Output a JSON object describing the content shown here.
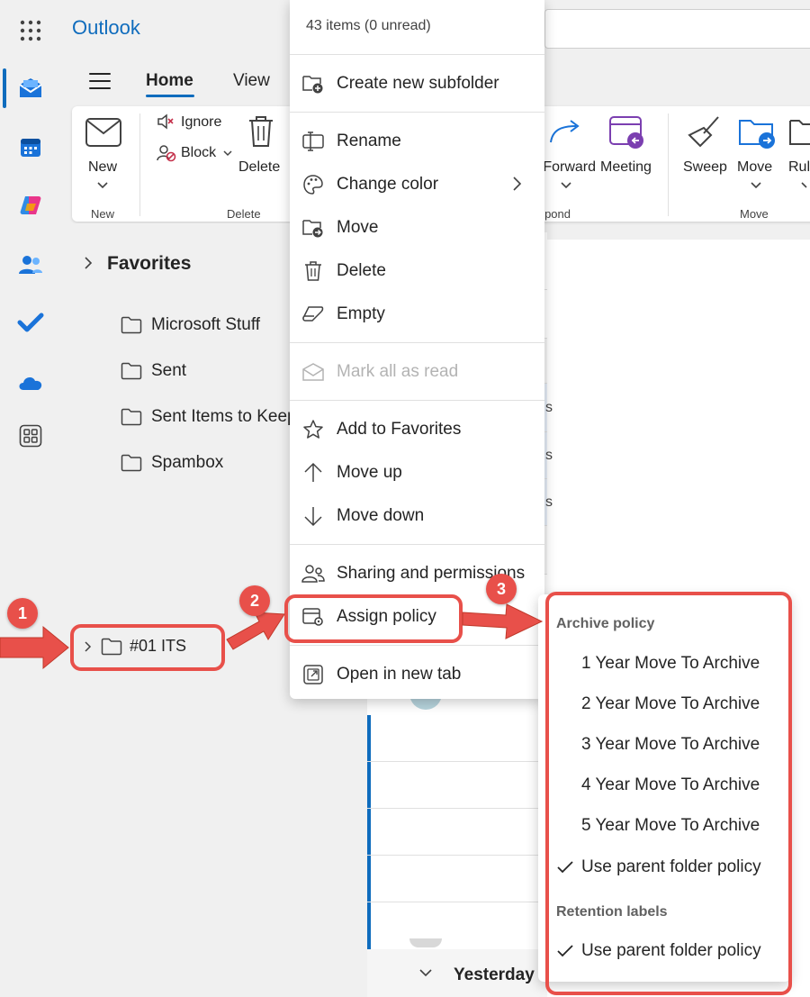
{
  "app": {
    "title": "Outlook"
  },
  "header": {
    "search_placeholder": ""
  },
  "tabs": [
    {
      "label": "Home"
    },
    {
      "label": "View"
    }
  ],
  "ribbon": {
    "new_label": "New",
    "new_group": "New",
    "ignore_label": "Ignore",
    "block_label": "Block",
    "delete_label": "Delete",
    "delete_group": "Delete",
    "forward_label": "Forward",
    "meeting_label": "Meeting",
    "respond_group": "Respond",
    "sweep_label": "Sweep",
    "move_label": "Move",
    "rules_label": "Rules",
    "move_group": "Move"
  },
  "nav": {
    "favorites_label": "Favorites",
    "folders": [
      "Microsoft Stuff",
      "Sent",
      "Sent Items to Keep",
      "Spambox"
    ],
    "selected_folder": "#01 ITS"
  },
  "message_list": {
    "snippets": [
      "s",
      "s",
      "s"
    ],
    "group_label": "Yesterday"
  },
  "context_menu": {
    "header": "43 items (0 unread)",
    "items": [
      {
        "label": "Create new subfolder",
        "icon": "folder-add-icon"
      },
      {
        "label": "Rename",
        "icon": "rename-icon"
      },
      {
        "label": "Change color",
        "icon": "palette-icon"
      },
      {
        "label": "Move",
        "icon": "folder-move-icon"
      },
      {
        "label": "Delete",
        "icon": "trash-icon"
      },
      {
        "label": "Empty",
        "icon": "eraser-icon"
      },
      {
        "label": "Mark all as read",
        "icon": "mail-read-icon",
        "disabled": true
      },
      {
        "label": "Add to Favorites",
        "icon": "star-icon"
      },
      {
        "label": "Move up",
        "icon": "arrow-up-icon"
      },
      {
        "label": "Move down",
        "icon": "arrow-down-icon"
      },
      {
        "label": "Sharing and permissions",
        "icon": "people-icon"
      },
      {
        "label": "Assign policy",
        "icon": "policy-icon"
      },
      {
        "label": "Open in new tab",
        "icon": "open-new-icon"
      }
    ]
  },
  "submenu": {
    "archive_heading": "Archive policy",
    "archive_items": [
      {
        "label": "1 Year Move To Archive",
        "checked": false
      },
      {
        "label": "2 Year Move To Archive",
        "checked": false
      },
      {
        "label": "3 Year Move To Archive",
        "checked": false
      },
      {
        "label": "4 Year Move To Archive",
        "checked": false
      },
      {
        "label": "5 Year Move To Archive",
        "checked": false
      },
      {
        "label": "Use parent folder policy",
        "checked": true
      }
    ],
    "retention_heading": "Retention labels",
    "retention_items": [
      {
        "label": "Use parent folder policy",
        "checked": true
      }
    ]
  },
  "annotations": {
    "step1": "1",
    "step2": "2",
    "step3": "3"
  },
  "colors": {
    "accent": "#0f6cbd",
    "annotation": "#e8504a",
    "selected_row": "#e6eef8"
  }
}
